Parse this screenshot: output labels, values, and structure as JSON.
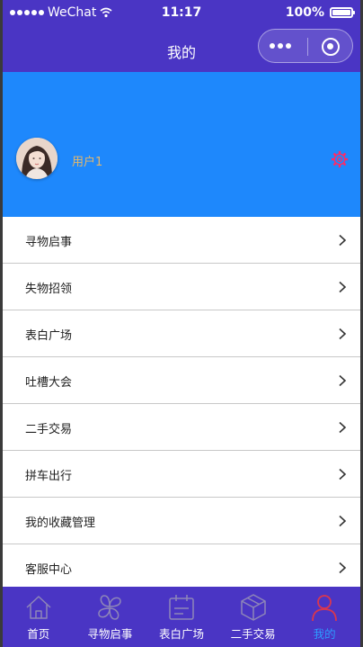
{
  "status_bar": {
    "carrier": "WeChat",
    "time": "11:17",
    "battery": "100%"
  },
  "nav": {
    "title": "我的"
  },
  "profile": {
    "username": "用户1",
    "avatar_icon": "avatar-image",
    "settings_icon": "gear-icon",
    "accent_color": "#ff2a66"
  },
  "menu": [
    {
      "label": "寻物启事"
    },
    {
      "label": "失物招领"
    },
    {
      "label": "表白广场"
    },
    {
      "label": "吐槽大会"
    },
    {
      "label": "二手交易"
    },
    {
      "label": "拼车出行"
    },
    {
      "label": "我的收藏管理"
    },
    {
      "label": "客服中心"
    }
  ],
  "tabs": [
    {
      "label": "首页",
      "icon": "home-icon"
    },
    {
      "label": "寻物启事",
      "icon": "clover-icon"
    },
    {
      "label": "表白广场",
      "icon": "calendar-icon"
    },
    {
      "label": "二手交易",
      "icon": "box-icon"
    },
    {
      "label": "我的",
      "icon": "user-icon",
      "active": true
    }
  ],
  "colors": {
    "header": "#4a35c4",
    "profile_bg": "#1e88fc",
    "active_tab": "#2d9bff",
    "active_icon": "#d9364f"
  }
}
